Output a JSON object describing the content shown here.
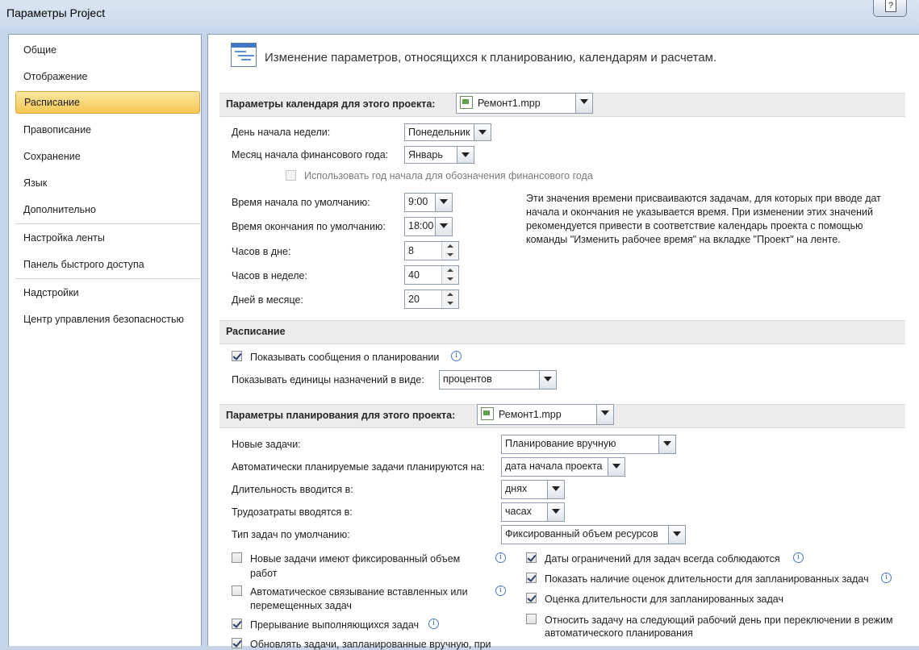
{
  "window": {
    "title": "Параметры Project",
    "help_glyph": "?"
  },
  "nav": {
    "items": [
      {
        "label": "Общие"
      },
      {
        "label": "Отображение"
      },
      {
        "label": "Расписание",
        "selected": true
      },
      {
        "label": "Правописание"
      },
      {
        "label": "Сохранение"
      },
      {
        "label": "Язык"
      },
      {
        "label": "Дополнительно"
      },
      {
        "label": "Настройка ленты"
      },
      {
        "label": "Панель быстрого доступа"
      },
      {
        "label": "Надстройки"
      },
      {
        "label": "Центр управления безопасностью"
      }
    ]
  },
  "header": {
    "text": "Изменение параметров, относящихся к планированию, календарям и расчетам.",
    "icon": "schedule-options-icon"
  },
  "calendar": {
    "title": "Параметры календаря для этого проекта:",
    "project": "Ремонт1.mpp",
    "week_start_label": "День начала недели:",
    "week_start_value": "Понедельник",
    "fiscal_month_label": "Месяц начала финансового года:",
    "fiscal_month_value": "Январь",
    "fiscal_year_checkbox": "Использовать год начала для обозначения финансового года",
    "default_start_label": "Время начала по умолчанию:",
    "default_start_value": "9:00",
    "default_end_label": "Время окончания по умолчанию:",
    "default_end_value": "18:00",
    "hours_day_label": "Часов в дне:",
    "hours_day_value": "8",
    "hours_week_label": "Часов в неделе:",
    "hours_week_value": "40",
    "days_month_label": "Дней в месяце:",
    "days_month_value": "20",
    "note": "Эти значения времени присваиваются задачам, для которых при вводе дат начала и окончания не указывается время. При изменении этих значений рекомендуется привести в соответствие календарь проекта с помощью команды \"Изменить рабочее время\" на вкладке \"Проект\" на ленте."
  },
  "schedule": {
    "title": "Расписание",
    "show_messages": "Показывать сообщения о планировании",
    "units_label": "Показывать единицы назначений в виде:",
    "units_value": "процентов"
  },
  "planning": {
    "title": "Параметры планирования для этого проекта:",
    "project": "Ремонт1.mpp",
    "new_tasks_label": "Новые задачи:",
    "new_tasks_value": "Планирование вручную",
    "auto_tasks_label": "Автоматически планируемые задачи планируются на:",
    "auto_tasks_value": "дата начала проекта",
    "duration_label": "Длительность вводится в:",
    "duration_value": "днях",
    "work_label": "Трудозатраты вводятся в:",
    "work_value": "часах",
    "task_type_label": "Тип задач по умолчанию:",
    "task_type_value": "Фиксированный объем ресурсов",
    "left_checks": [
      {
        "text1": "Новые задачи имеют фиксированный объем",
        "text2": "работ",
        "checked": false
      },
      {
        "text1": "Автоматическое связывание вставленных или",
        "text2": "перемещенных задач",
        "checked": false
      },
      {
        "text1": "Прерывание выполняющихся задач",
        "checked": true
      },
      {
        "text1": "Обновлять задачи, запланированные вручную, при",
        "checked": true
      }
    ],
    "right_checks": [
      {
        "text1": "Даты ограничений для задач всегда соблюдаются",
        "checked": true
      },
      {
        "text1": "Показать наличие оценок длительности для запланированных задач",
        "checked": true
      },
      {
        "text1": "Оценка длительности для запланированных задач",
        "checked": true
      },
      {
        "text1": "Относить задачу на следующий рабочий день при переключении в режим",
        "text2": "автоматического планирования",
        "checked": false
      }
    ]
  },
  "info_glyph": "i"
}
